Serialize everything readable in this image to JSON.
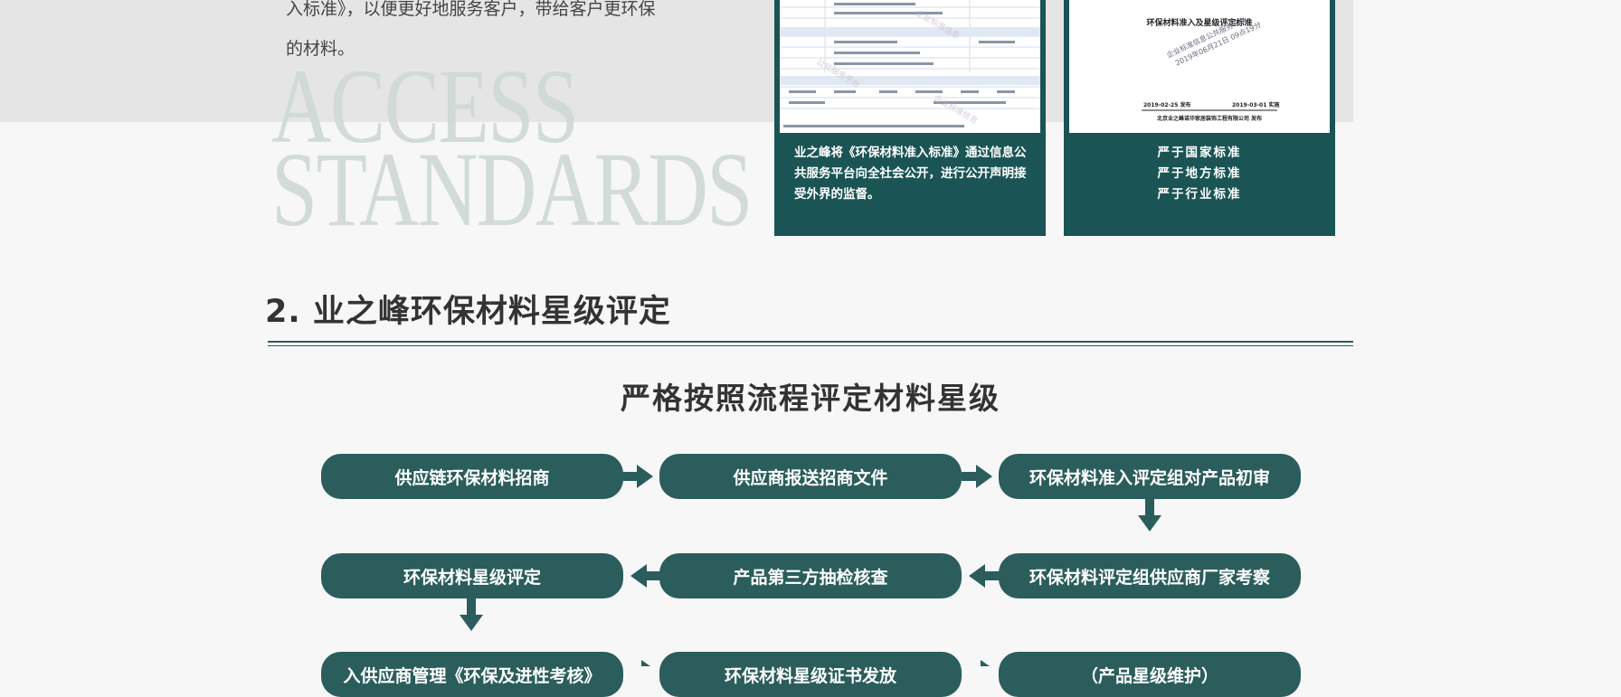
{
  "intro": {
    "line1": "入标准》，以便更好地服务客户，带给客户更环保",
    "line2": "的材料。"
  },
  "watermark": {
    "line1": "ACCESS",
    "line2": "STANDARDS"
  },
  "card_publicity": {
    "caption": "业之峰将《环保材料准入标准》通过信息公共服务平台向全社会公开，进行公开声明接受外界的监督。"
  },
  "card_standard": {
    "doc_title": "环保材料准入及星级评定标准",
    "doc_stamp": "企业标准信息公共服务平台",
    "doc_date": "2019年06月21日 09点19分",
    "doc_release": "2019-02-25 发布",
    "doc_effective": "2019-03-01 实施",
    "doc_company": "北京业之峰诺华家居装饰工程有限公司 发布",
    "lines": [
      "严于国家标准",
      "严于地方标准",
      "严于行业标准"
    ]
  },
  "section": {
    "title": "2. 业之峰环保材料星级评定",
    "subtitle": "严格按照流程评定材料星级"
  },
  "flow": {
    "row1": [
      "供应链环保材料招商",
      "供应商报送招商文件",
      "环保材料准入评定组对产品初审"
    ],
    "row2": [
      "环保材料星级评定",
      "产品第三方抽检核查",
      "环保材料评定组供应商厂家考察"
    ],
    "row3": [
      "入供应商管理《环保及进性考核》",
      "环保材料星级证书发放",
      "（产品星级维护）"
    ]
  },
  "colors": {
    "teal_dark": "#1b5454",
    "teal_step": "#2a5d5c",
    "background": "#f7f7f7",
    "band": "#e5e5e5"
  }
}
